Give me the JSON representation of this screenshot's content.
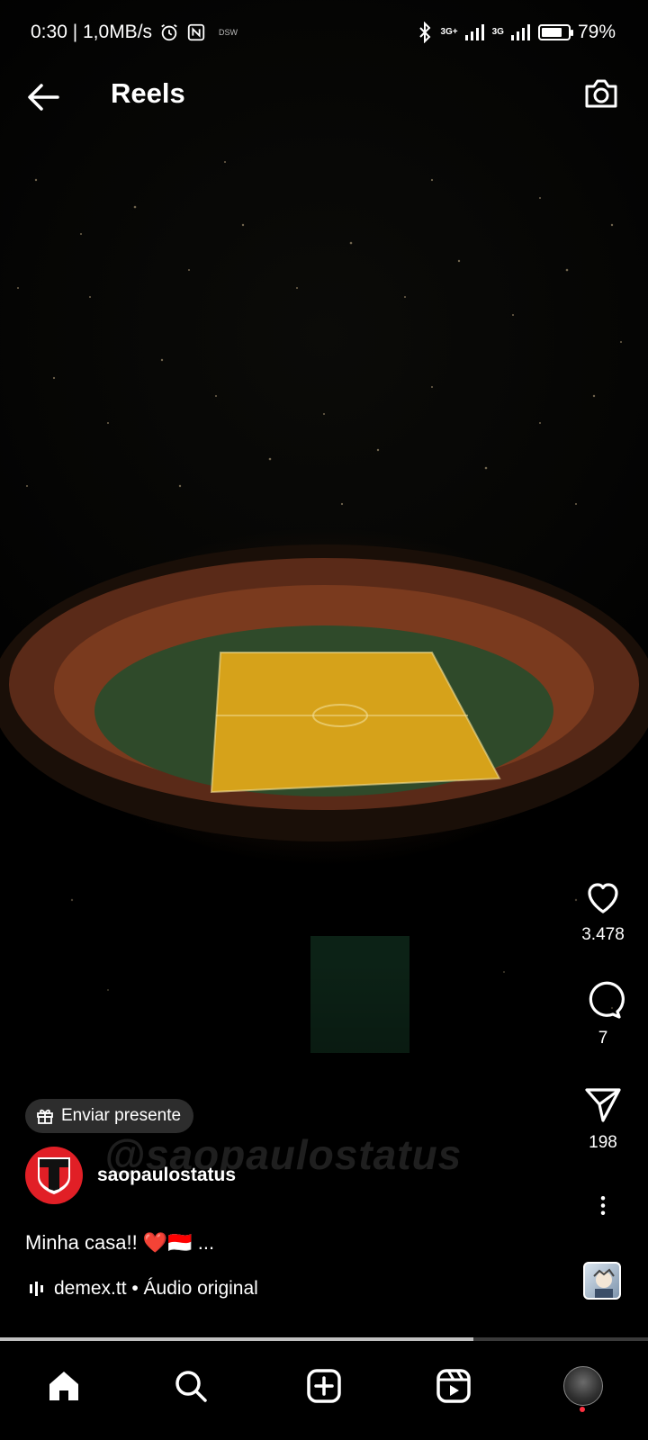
{
  "status_bar": {
    "time_speed": "0:30 | 1,0MB/s",
    "small_label": "DSW",
    "net1": "3G+",
    "net2": "3G",
    "battery": "79%",
    "battery_level": 0.79
  },
  "header": {
    "title": "Reels"
  },
  "actions": {
    "likes": "3.478",
    "comments": "7",
    "shares": "198"
  },
  "gift": {
    "label": "Enviar presente"
  },
  "author": {
    "username": "saopaulostatus",
    "avatar_text": "SÃO PAULO"
  },
  "caption": {
    "text": "Minha casa!! ❤️🇮🇩 ..."
  },
  "audio": {
    "label": "demex.tt • Áudio original"
  },
  "watermark": "@saopaulostatus",
  "progress": 0.73,
  "colors": {
    "accent_red": "#e11f26",
    "notification_dot": "#ff3040",
    "pitch": "#d6a21a"
  },
  "nav": {
    "items": [
      "home-icon",
      "search-icon",
      "create-icon",
      "reels-icon",
      "profile-avatar"
    ]
  }
}
